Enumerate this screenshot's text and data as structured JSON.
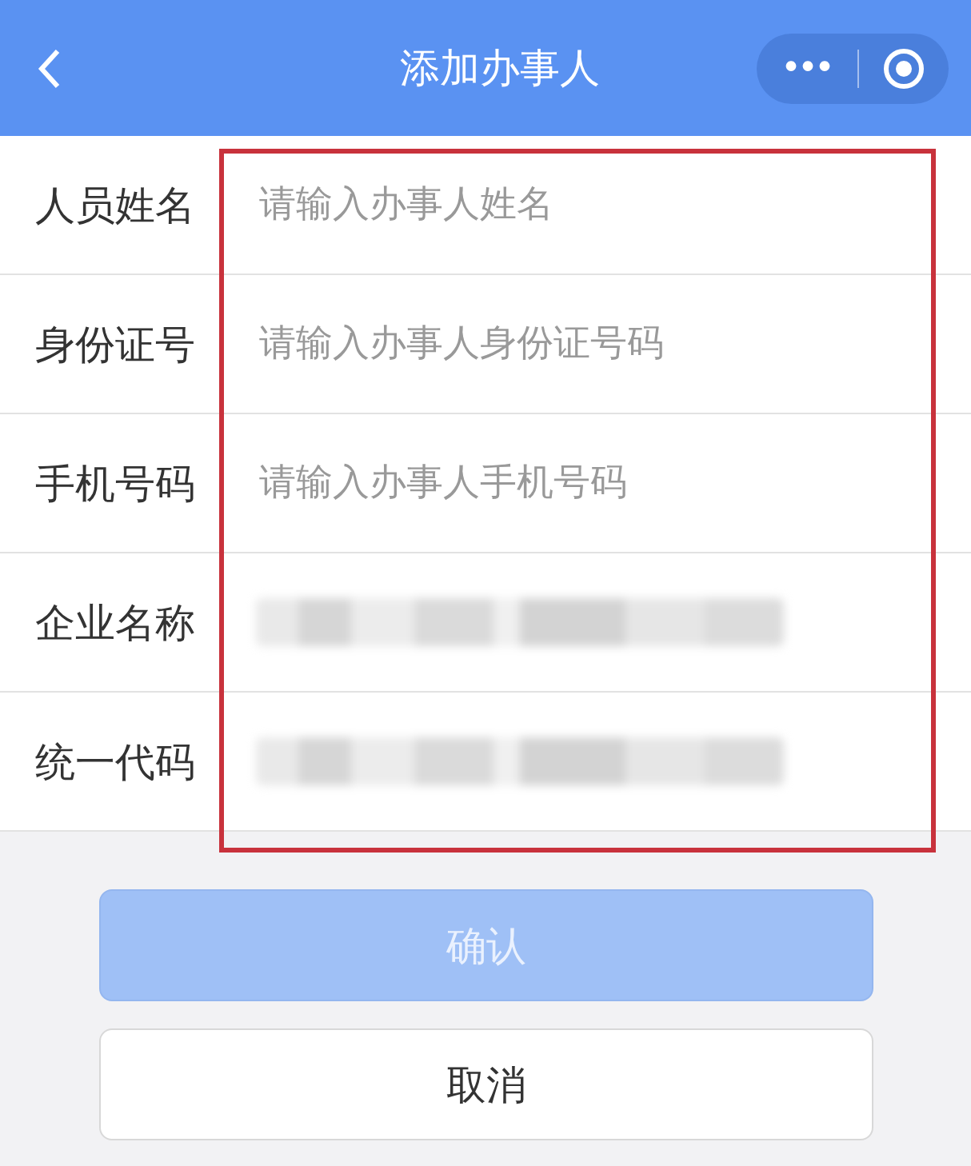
{
  "header": {
    "title": "添加办事人",
    "menu_dots": "•••"
  },
  "form": {
    "highlighted": true,
    "rows": [
      {
        "label": "人员姓名",
        "kind": "input",
        "placeholder": "请输入办事人姓名"
      },
      {
        "label": "身份证号",
        "kind": "input",
        "placeholder": "请输入办事人身份证号码"
      },
      {
        "label": "手机号码",
        "kind": "input",
        "placeholder": "请输入办事人手机号码"
      },
      {
        "label": "企业名称",
        "kind": "blurred"
      },
      {
        "label": "统一代码",
        "kind": "blurred"
      }
    ]
  },
  "buttons": [
    {
      "label": "确认",
      "kind": "primary",
      "disabled": true
    },
    {
      "label": "取消",
      "kind": "secondary",
      "disabled": false
    }
  ]
}
